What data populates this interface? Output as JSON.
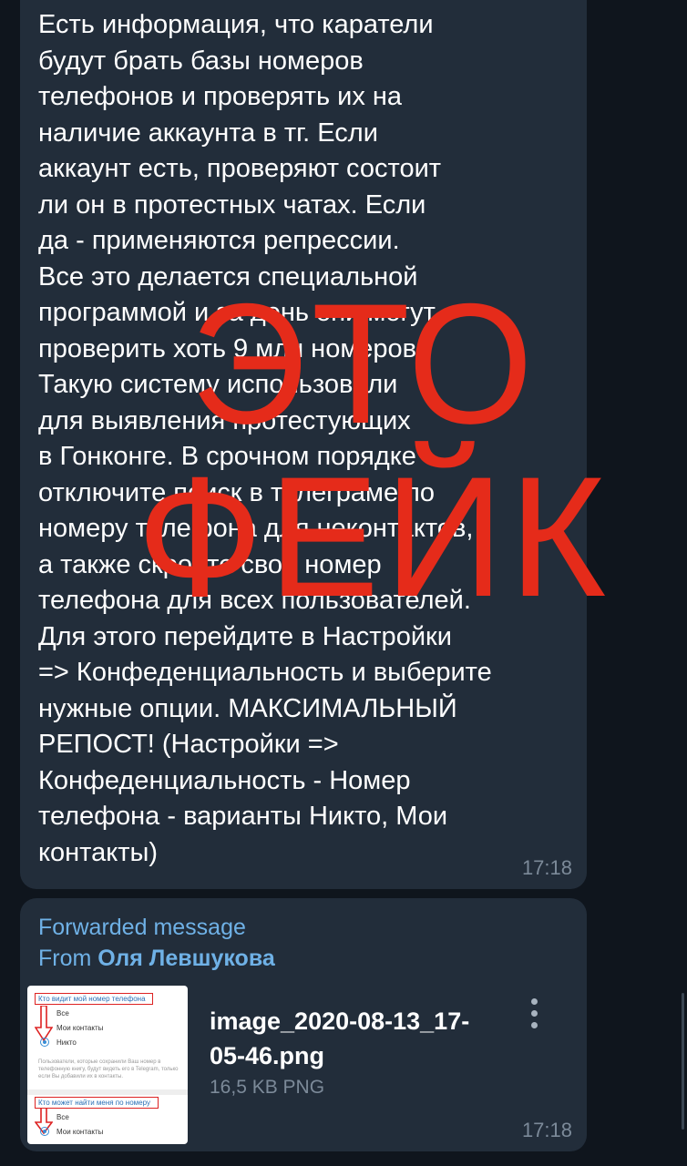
{
  "message1": {
    "text": "Есть информация, что каратели\nбудут брать базы номеров\nтелефонов и проверять их на\nналичие аккаунта в тг. Если\nаккаунт есть, проверяют состоит\nли он в протестных чатах. Если\nда - применяются репрессии.\nВсе это делается специальной\nпрограммой и за день они могут\nпроверить хоть 9 млн номеров.\nТакую систему использовали\nдля выявления протестующих\nв Гонконге. В срочном порядке\nотключите поиск в телеграме по\nномеру телефона для неконтактов,\nа также скройте свой номер\nтелефона для всех пользователей.\nДля этого перейдите в Настройки\n=> Конфеденциальность и выберите\nнужные опции.   МАКСИМАЛЬНЫЙ\nРЕПОСТ! (Настройки =>\nКонфеденциальность - Номер\nтелефона - варианты Никто, Мои\nконтакты)",
    "time": "17:18",
    "stamp_line1": "ЭТО",
    "stamp_line2": "ФЕЙК"
  },
  "message2": {
    "forwarded_label": "Forwarded message",
    "from_prefix": "From",
    "from_name": "Оля Левшукова",
    "file_name": "image_2020-08-13_17-\n05-46.png",
    "file_meta": "16,5 KB PNG",
    "time": "17:18",
    "thumbnail": {
      "heading1": "Кто видит мой номер телефона",
      "options1": [
        "Все",
        "Мои контакты",
        "Никто"
      ],
      "note": "Пользователи, которые сохранили Ваш номер в телефонную книгу, будут видеть его в Telegram, только если Вы добавили их в контакты.",
      "heading2": "Кто может найти меня по номеру",
      "options2": [
        "Все",
        "Мои контакты"
      ]
    }
  },
  "colors": {
    "background": "#0f151d",
    "bubble": "#222d3a",
    "stamp": "#e52b1a",
    "link": "#6fb1e6"
  }
}
